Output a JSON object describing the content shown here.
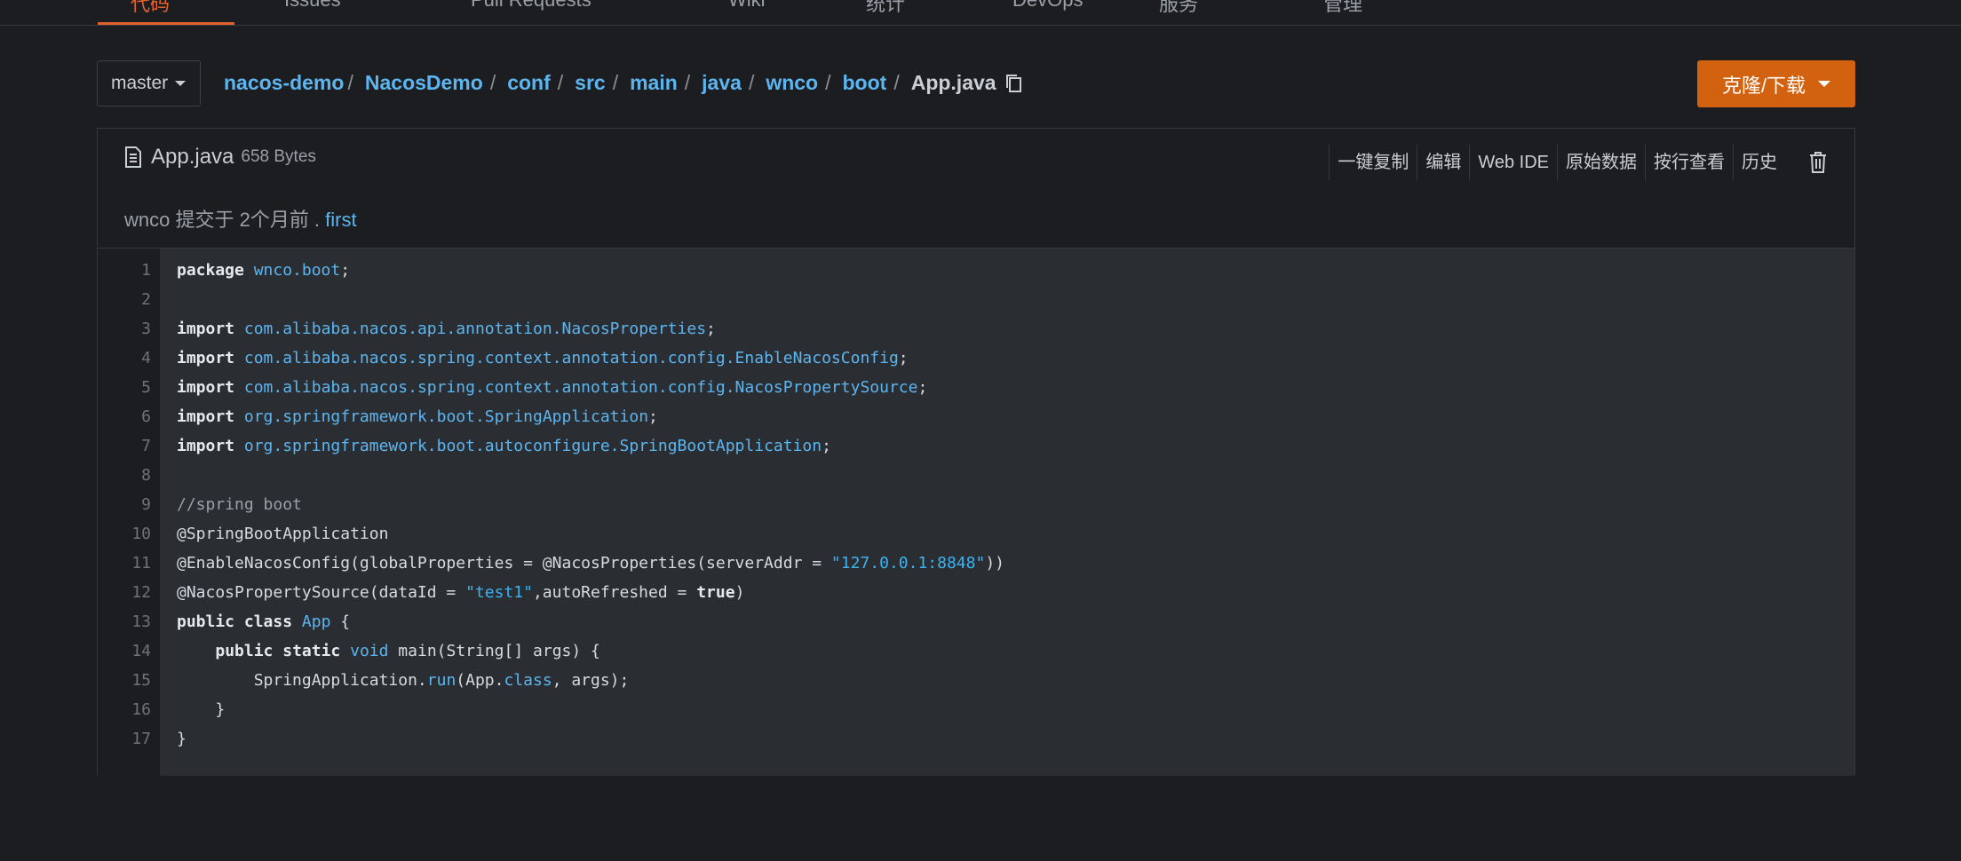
{
  "nav": {
    "tabs": [
      {
        "label": "代码",
        "active": true
      },
      {
        "label": "Issues",
        "active": false
      },
      {
        "label": "Pull Requests",
        "active": false
      },
      {
        "label": "Wiki",
        "active": false
      },
      {
        "label": "统计",
        "active": false
      },
      {
        "label": "DevOps",
        "active": false
      },
      {
        "label": "服务",
        "active": false
      },
      {
        "label": "管理",
        "active": false
      }
    ]
  },
  "branch": {
    "label": "master"
  },
  "breadcrumb": {
    "segments": [
      "nacos-demo",
      "NacosDemo",
      "conf",
      "src",
      "main",
      "java",
      "wnco",
      "boot"
    ],
    "current": "App.java"
  },
  "clone_button": {
    "label": "克隆/下载"
  },
  "file": {
    "name": "App.java",
    "size": "658 Bytes"
  },
  "actions": [
    "一键复制",
    "编辑",
    "Web IDE",
    "原始数据",
    "按行查看",
    "历史"
  ],
  "commit": {
    "text": "wnco 提交于 2个月前 .",
    "message": "first"
  },
  "code": {
    "lines": [
      {
        "n": "1",
        "html": "<span class='kw'>package</span> <span class='pkg'>wnco.boot</span>;"
      },
      {
        "n": "2",
        "html": ""
      },
      {
        "n": "3",
        "html": "<span class='kw'>import</span> <span class='pkg'>com.alibaba.nacos.api.annotation.NacosProperties</span>;"
      },
      {
        "n": "4",
        "html": "<span class='kw'>import</span> <span class='pkg'>com.alibaba.nacos.spring.context.annotation.config.EnableNacosConfig</span>;"
      },
      {
        "n": "5",
        "html": "<span class='kw'>import</span> <span class='pkg'>com.alibaba.nacos.spring.context.annotation.config.NacosPropertySource</span>;"
      },
      {
        "n": "6",
        "html": "<span class='kw'>import</span> <span class='pkg'>org.springframework.boot.SpringApplication</span>;"
      },
      {
        "n": "7",
        "html": "<span class='kw'>import</span> <span class='pkg'>org.springframework.boot.autoconfigure.SpringBootApplication</span>;"
      },
      {
        "n": "8",
        "html": ""
      },
      {
        "n": "9",
        "html": "<span class='cm'>//spring boot</span>"
      },
      {
        "n": "10",
        "html": "@SpringBootApplication"
      },
      {
        "n": "11",
        "html": "@EnableNacosConfig(globalProperties = @NacosProperties(serverAddr = <span class='str'>\"127.0.0.1:8848\"</span>))"
      },
      {
        "n": "12",
        "html": "@NacosPropertySource(dataId = <span class='str'>\"test1\"</span>,autoRefreshed = <span class='kw'>true</span>)"
      },
      {
        "n": "13",
        "html": "<span class='kw'>public</span> <span class='kw'>class</span> <span class='typ'>App</span> {"
      },
      {
        "n": "14",
        "html": "    <span class='kw'>public</span> <span class='kw'>static</span> <span class='typ'>void</span> main(String[] args) {"
      },
      {
        "n": "15",
        "html": "        SpringApplication.<span class='typ'>run</span>(App.<span class='typ'>class</span>, args);"
      },
      {
        "n": "16",
        "html": "    }"
      },
      {
        "n": "17",
        "html": "}"
      }
    ]
  },
  "colors": {
    "accent": "#e0622f",
    "link": "#5db5f0",
    "clone_bg": "#d2620f"
  }
}
